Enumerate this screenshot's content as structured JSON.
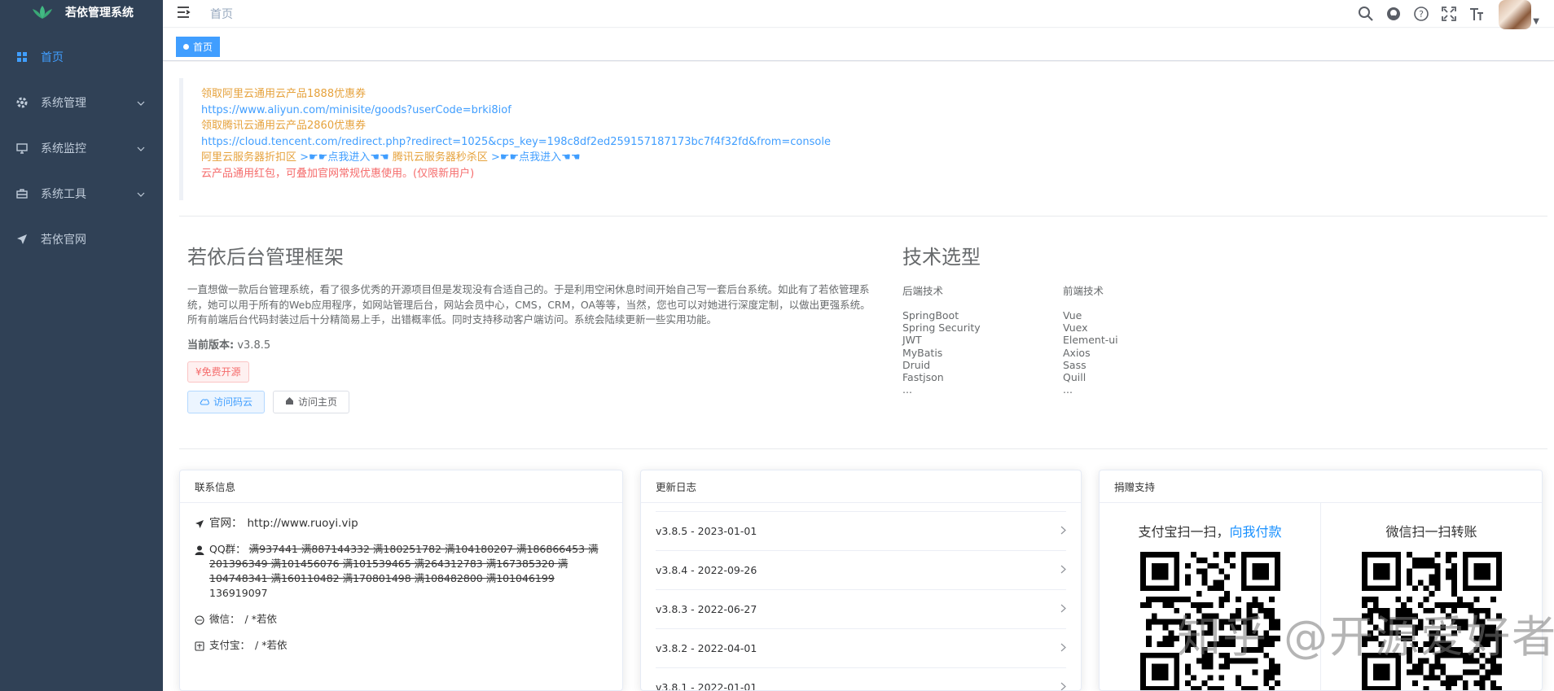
{
  "app": {
    "title": "若依管理系统"
  },
  "sidebar": {
    "items": [
      {
        "label": "首页",
        "icon": "dashboard-icon",
        "active": true
      },
      {
        "label": "系统管理",
        "icon": "gear-icon"
      },
      {
        "label": "系统监控",
        "icon": "monitor-icon"
      },
      {
        "label": "系统工具",
        "icon": "toolbox-icon"
      },
      {
        "label": "若依官网",
        "icon": "send-icon"
      }
    ]
  },
  "navbar": {
    "breadcrumb": "首页"
  },
  "tags": {
    "home": "首页"
  },
  "notice": {
    "line1": "领取阿里云通用云产品1888优惠券",
    "line2": "https://www.aliyun.com/minisite/goods?userCode=brki8iof",
    "line3": "领取腾讯云通用云产品2860优惠券",
    "line4": "https://cloud.tencent.com/redirect.php?redirect=1025&cps_key=198c8df2ed259157187173bc7f4f32fd&from=console",
    "line5a": "阿里云服务器折扣区",
    "line5b": ">☛☛点我进入☚☚",
    "line5c": "腾讯云服务器秒杀区",
    "line5d": ">☛☛点我进入☚☚",
    "line6": "云产品通用红包，可叠加官网常规优惠使用。(仅限新用户)"
  },
  "intro": {
    "title": "若依后台管理框架",
    "desc": "一直想做一款后台管理系统，看了很多优秀的开源项目但是发现没有合适自己的。于是利用空闲休息时间开始自己写一套后台系统。如此有了若依管理系统，她可以用于所有的Web应用程序，如网站管理后台，网站会员中心，CMS，CRM，OA等等，当然，您也可以对她进行深度定制，以做出更强系统。所有前端后台代码封装过后十分精简易上手，出错概率低。同时支持移动客户端访问。系统会陆续更新一些实用功能。",
    "version_label": "当前版本:",
    "version_value": "v3.8.5",
    "free_tag": "¥免费开源",
    "btn_gitee": "访问码云",
    "btn_home": "访问主页"
  },
  "tech": {
    "title": "技术选型",
    "backend_title": "后端技术",
    "backend": [
      "SpringBoot",
      "Spring Security",
      "JWT",
      "MyBatis",
      "Druid",
      "Fastjson",
      "..."
    ],
    "frontend_title": "前端技术",
    "frontend": [
      "Vue",
      "Vuex",
      "Element-ui",
      "Axios",
      "Sass",
      "Quill",
      "..."
    ]
  },
  "contact": {
    "header": "联系信息",
    "website_label": "官网：",
    "website_value": "http://www.ruoyi.vip",
    "qq_label": "QQ群：",
    "qq_struck": "满937441 满887144332 满180251782 满104180207 满186866453 满201396349 满101456076 满101539465 满264312783 满167385320 满104748341 满160110482 满170801498 满108482800 满101046199",
    "qq_open": "136919097",
    "wechat_label": "微信：",
    "wechat_value": "/ *若依",
    "alipay_label": "支付宝：",
    "alipay_value": "/ *若依"
  },
  "changelog": {
    "header": "更新日志",
    "items": [
      "v3.8.5 - 2023-01-01",
      "v3.8.4 - 2022-09-26",
      "v3.8.3 - 2022-06-27",
      "v3.8.2 - 2022-04-01",
      "v3.8.1 - 2022-01-01"
    ]
  },
  "donate": {
    "header": "捐赠支持",
    "alipay_title": "支付宝扫一扫，",
    "alipay_pay": "向我付款",
    "wechat_title": "微信扫一扫转账"
  },
  "watermark": "知乎 @开源爱好者"
}
